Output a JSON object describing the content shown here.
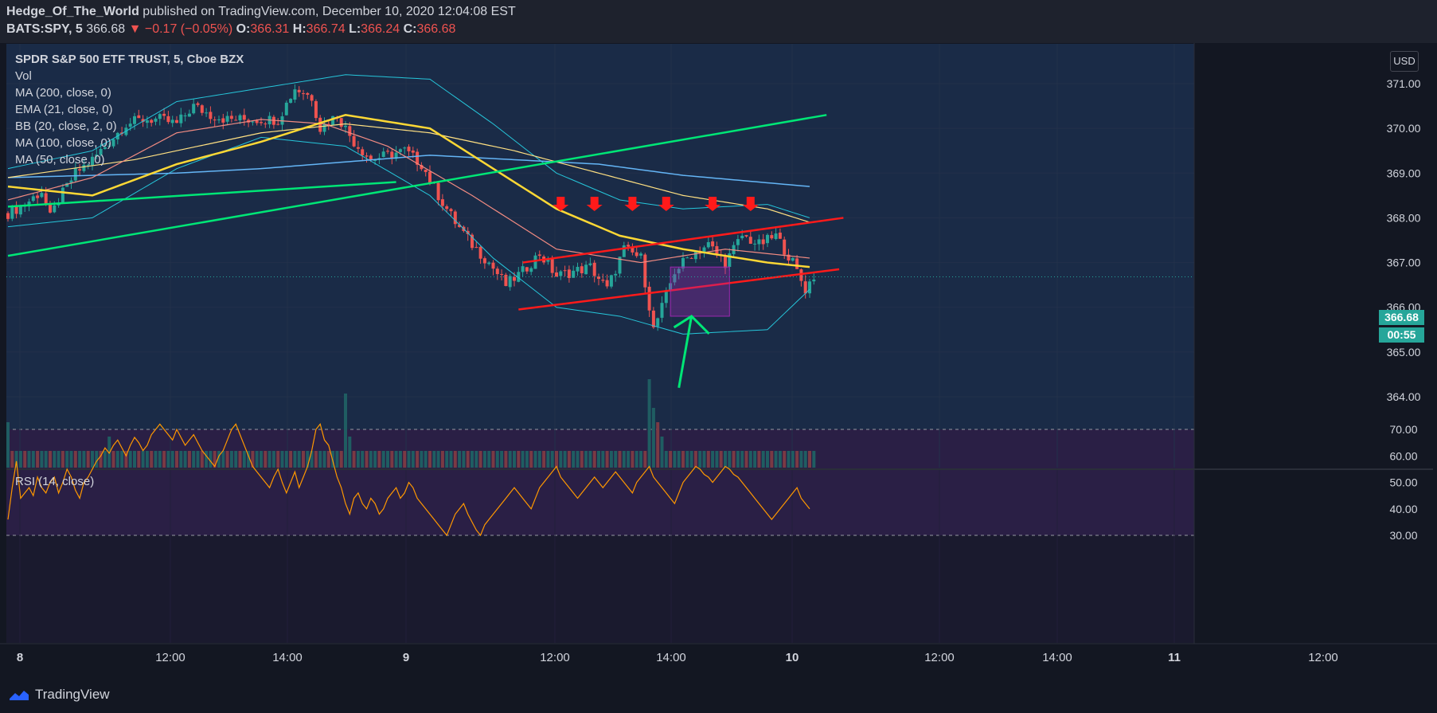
{
  "header": {
    "author": "Hedge_Of_The_World",
    "published": "published on TradingView.com, December 10, 2020 12:04:08 EST",
    "symbol": "BATS:SPY, 5",
    "last": "366.68",
    "change": "▼ −0.17 (−0.05%)",
    "o_label": "O:",
    "o": "366.31",
    "h_label": "H:",
    "h": "366.74",
    "l_label": "L:",
    "l": "366.24",
    "c_label": "C:",
    "c": "366.68"
  },
  "indicators": [
    "SPDR S&P 500 ETF TRUST, 5, Cboe BZX",
    "Vol",
    "MA (200, close, 0)",
    "EMA (21, close, 0)",
    "BB (20, close, 2, 0)",
    "MA (100, close, 0)",
    "MA (50, close, 0)"
  ],
  "rsi_label": "RSI (14, close)",
  "currency": "USD",
  "last_price_tag": "366.68",
  "countdown_tag": "00:55",
  "footer_logo": "TradingView",
  "colors": {
    "up": "#26a69a",
    "down": "#ef5350",
    "ma200": "#64b5f6",
    "ema21": "#f28b82",
    "bb": "#26c6da",
    "ma100": "#ffe082",
    "ma50": "#fdd835",
    "trend": "#00e676",
    "channel": "#ff1a1a",
    "rsi": "#ff9800",
    "box": "#9c27b0"
  },
  "chart_data": [
    {
      "type": "candlestick",
      "title": "SPDR S&P 500 ETF TRUST, 5, Cboe BZX",
      "ylim": [
        363.8,
        371.7
      ],
      "yticks": [
        "371.00",
        "370.00",
        "369.00",
        "368.00",
        "367.00",
        "366.00",
        "365.00",
        "364.00"
      ],
      "xticks": [
        "8",
        "12:00",
        "14:00",
        "9",
        "12:00",
        "14:00",
        "10",
        "12:00",
        "14:00",
        "11",
        "12:00"
      ],
      "xlabel": "",
      "ylabel": "",
      "close_path": [
        [
          0,
          368.1
        ],
        [
          4,
          368.3
        ],
        [
          8,
          368.6
        ],
        [
          10,
          368.0
        ],
        [
          12,
          368.4
        ],
        [
          16,
          369.0
        ],
        [
          20,
          369.3
        ],
        [
          24,
          369.7
        ],
        [
          28,
          370.1
        ],
        [
          32,
          370.2
        ],
        [
          36,
          370.2
        ],
        [
          40,
          370.1
        ],
        [
          44,
          370.5
        ],
        [
          48,
          370.3
        ],
        [
          52,
          370.2
        ],
        [
          56,
          370.2
        ],
        [
          60,
          370.2
        ],
        [
          64,
          370.2
        ],
        [
          68,
          370.9
        ],
        [
          72,
          370.7
        ],
        [
          74,
          370.0
        ],
        [
          78,
          370.3
        ],
        [
          82,
          369.7
        ],
        [
          86,
          369.3
        ],
        [
          90,
          369.4
        ],
        [
          94,
          369.5
        ],
        [
          98,
          369.2
        ],
        [
          102,
          368.5
        ],
        [
          106,
          367.9
        ],
        [
          110,
          367.4
        ],
        [
          114,
          367.0
        ],
        [
          118,
          366.5
        ],
        [
          122,
          366.8
        ],
        [
          126,
          367.2
        ],
        [
          130,
          366.7
        ],
        [
          134,
          366.8
        ],
        [
          138,
          366.9
        ],
        [
          142,
          366.4
        ],
        [
          146,
          367.3
        ],
        [
          150,
          367.1
        ],
        [
          153,
          365.5
        ],
        [
          155,
          366.0
        ],
        [
          158,
          366.8
        ],
        [
          162,
          367.2
        ],
        [
          166,
          367.4
        ],
        [
          170,
          367.0
        ],
        [
          174,
          367.6
        ],
        [
          178,
          367.4
        ],
        [
          182,
          367.6
        ],
        [
          186,
          367.0
        ],
        [
          189,
          366.4
        ],
        [
          191,
          366.7
        ]
      ],
      "ma200": [
        [
          0,
          368.9
        ],
        [
          40,
          369.0
        ],
        [
          60,
          369.1
        ],
        [
          100,
          369.4
        ],
        [
          140,
          369.2
        ],
        [
          160,
          368.95
        ],
        [
          190,
          368.7
        ]
      ],
      "ema21": [
        [
          0,
          368.4
        ],
        [
          20,
          368.9
        ],
        [
          40,
          369.9
        ],
        [
          60,
          370.2
        ],
        [
          75,
          370.1
        ],
        [
          90,
          369.6
        ],
        [
          110,
          368.5
        ],
        [
          130,
          367.3
        ],
        [
          150,
          367.0
        ],
        [
          170,
          367.3
        ],
        [
          190,
          367.1
        ]
      ],
      "ma100": [
        [
          0,
          368.9
        ],
        [
          30,
          369.3
        ],
        [
          60,
          369.9
        ],
        [
          80,
          370.1
        ],
        [
          100,
          369.9
        ],
        [
          120,
          369.5
        ],
        [
          140,
          369.0
        ],
        [
          160,
          368.5
        ],
        [
          180,
          368.2
        ],
        [
          190,
          367.9
        ]
      ],
      "ma50": [
        [
          0,
          368.7
        ],
        [
          20,
          368.5
        ],
        [
          40,
          369.2
        ],
        [
          60,
          369.7
        ],
        [
          80,
          370.3
        ],
        [
          100,
          370.0
        ],
        [
          115,
          369.1
        ],
        [
          130,
          368.2
        ],
        [
          145,
          367.6
        ],
        [
          160,
          367.3
        ],
        [
          180,
          367.0
        ],
        [
          190,
          366.9
        ]
      ],
      "bb_upper": [
        [
          0,
          369.1
        ],
        [
          20,
          369.5
        ],
        [
          40,
          370.6
        ],
        [
          60,
          370.9
        ],
        [
          80,
          371.2
        ],
        [
          100,
          371.1
        ],
        [
          115,
          370.1
        ],
        [
          130,
          369.0
        ],
        [
          145,
          368.4
        ],
        [
          160,
          368.2
        ],
        [
          180,
          368.3
        ],
        [
          190,
          368.0
        ]
      ],
      "bb_lower": [
        [
          0,
          367.8
        ],
        [
          20,
          368.0
        ],
        [
          40,
          369.1
        ],
        [
          60,
          369.8
        ],
        [
          80,
          369.6
        ],
        [
          100,
          368.5
        ],
        [
          115,
          367.1
        ],
        [
          130,
          366.0
        ],
        [
          145,
          365.8
        ],
        [
          160,
          365.4
        ],
        [
          180,
          365.5
        ],
        [
          190,
          366.4
        ]
      ],
      "volume": [
        3,
        1,
        1,
        1,
        1,
        1,
        1,
        1,
        1,
        1,
        1,
        1,
        1,
        1,
        1,
        1,
        1,
        1,
        1,
        1,
        1,
        1,
        1,
        1,
        2,
        1,
        1,
        1,
        1,
        1,
        1,
        1,
        1,
        1,
        1,
        1,
        1,
        1,
        1,
        1,
        1,
        1,
        1,
        1,
        1,
        1,
        1,
        1,
        1,
        1,
        1,
        1,
        1,
        1,
        1,
        1,
        1,
        1,
        1,
        1,
        1,
        1,
        1,
        1,
        1,
        1,
        1,
        1,
        1,
        1,
        1,
        1,
        1,
        1,
        1,
        1,
        1,
        1,
        1,
        1,
        5,
        2,
        1,
        1,
        1,
        1,
        1,
        1,
        1,
        1,
        1,
        1,
        1,
        1,
        1,
        1,
        1,
        1,
        1,
        1,
        1,
        1,
        1,
        1,
        1,
        1,
        1,
        1,
        1,
        1,
        1,
        1,
        1,
        1,
        1,
        1,
        1,
        1,
        1,
        1,
        1,
        1,
        1,
        1,
        1,
        1,
        1,
        1,
        1,
        1,
        1,
        1,
        1,
        1,
        1,
        1,
        1,
        1,
        1,
        1,
        1,
        1,
        1,
        1,
        1,
        1,
        1,
        1,
        1,
        1,
        1,
        1,
        6,
        4,
        3,
        2,
        1,
        1,
        1,
        1,
        1,
        1,
        1,
        1,
        1,
        1,
        1,
        1,
        1,
        1,
        1,
        1,
        1,
        1,
        1,
        1,
        1,
        1,
        1,
        1,
        1,
        1,
        1,
        1,
        1,
        1,
        1,
        1,
        1,
        1,
        1,
        1
      ],
      "trendlines": [
        {
          "from": [
            0,
            368.25
          ],
          "to": [
            92,
            368.8
          ]
        },
        {
          "from": [
            0,
            367.15
          ],
          "to": [
            194,
            370.3
          ]
        },
        {
          "from": [
            122,
            367.0
          ],
          "to": [
            198,
            368.0
          ]
        },
        {
          "from": [
            121,
            365.95
          ],
          "to": [
            197,
            366.85
          ]
        }
      ],
      "resistance_arrows": [
        131,
        139,
        148,
        156,
        167,
        176
      ],
      "support_arrow": {
        "from": [
          159,
          364.2
        ],
        "to": [
          162,
          365.8
        ]
      },
      "highlight_box": {
        "x": [
          157,
          171
        ],
        "y": [
          365.8,
          366.9
        ]
      }
    },
    {
      "type": "line",
      "title": "RSI (14, close)",
      "ylim": [
        25,
        75
      ],
      "yticks": [
        "70.00",
        "60.00",
        "50.00",
        "40.00",
        "30.00"
      ],
      "band": [
        30,
        70
      ],
      "values": [
        36,
        48,
        58,
        44,
        46,
        48,
        45,
        52,
        48,
        46,
        50,
        52,
        46,
        50,
        55,
        52,
        47,
        44,
        50,
        52,
        55,
        58,
        60,
        63,
        61,
        64,
        66,
        63,
        60,
        64,
        67,
        65,
        62,
        64,
        68,
        70,
        72,
        70,
        68,
        66,
        70,
        67,
        64,
        66,
        68,
        65,
        62,
        60,
        58,
        56,
        60,
        62,
        66,
        70,
        72,
        68,
        64,
        60,
        56,
        54,
        52,
        50,
        48,
        52,
        55,
        50,
        46,
        50,
        54,
        48,
        52,
        56,
        62,
        70,
        72,
        66,
        64,
        58,
        52,
        48,
        42,
        38,
        44,
        46,
        42,
        40,
        44,
        42,
        38,
        40,
        44,
        46,
        48,
        44,
        46,
        50,
        48,
        44,
        42,
        40,
        38,
        36,
        34,
        32,
        30,
        34,
        38,
        40,
        42,
        38,
        35,
        32,
        30,
        34,
        36,
        38,
        40,
        42,
        44,
        46,
        48,
        46,
        44,
        42,
        40,
        44,
        48,
        50,
        52,
        54,
        56,
        52,
        50,
        48,
        46,
        44,
        46,
        48,
        50,
        52,
        50,
        48,
        50,
        52,
        54,
        52,
        50,
        48,
        46,
        50,
        52,
        54,
        56,
        52,
        50,
        48,
        46,
        44,
        42,
        46,
        50,
        52,
        54,
        56,
        55,
        53,
        52,
        50,
        52,
        54,
        56,
        55,
        53,
        52,
        50,
        48,
        46,
        44,
        42,
        40,
        38,
        36,
        38,
        40,
        42,
        44,
        46,
        48,
        44,
        42,
        40
      ]
    }
  ]
}
